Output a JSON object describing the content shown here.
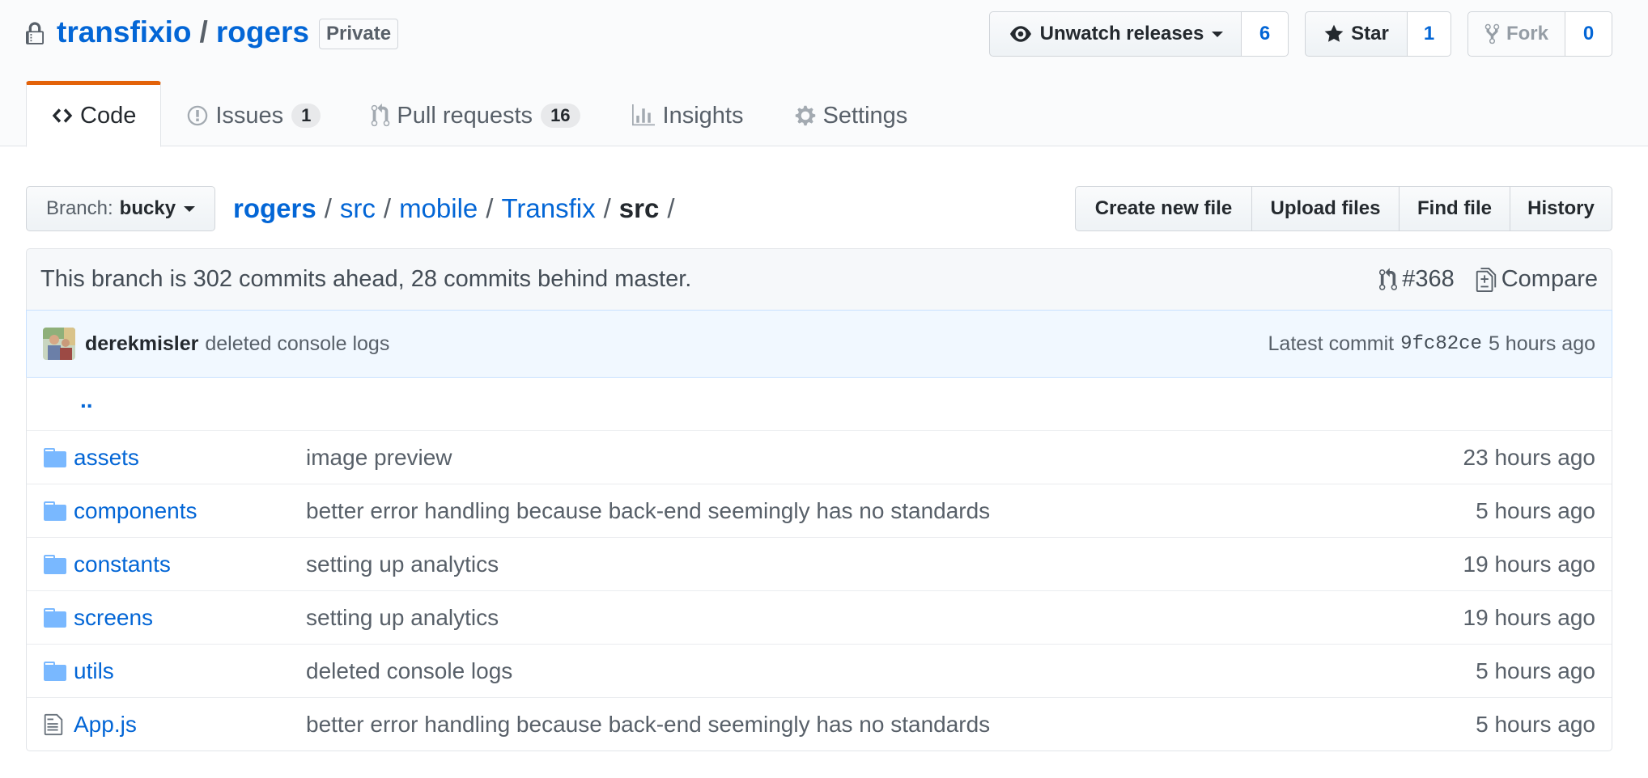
{
  "repo": {
    "owner": "transfixio",
    "separator": "/",
    "name": "rogers",
    "visibility": "Private"
  },
  "actions": {
    "watch": {
      "label": "Unwatch releases",
      "count": "6"
    },
    "star": {
      "label": "Star",
      "count": "1"
    },
    "fork": {
      "label": "Fork",
      "count": "0"
    }
  },
  "nav": {
    "code": "Code",
    "issues": {
      "label": "Issues",
      "count": "1"
    },
    "pulls": {
      "label": "Pull requests",
      "count": "16"
    },
    "insights": "Insights",
    "settings": "Settings"
  },
  "branch": {
    "prefix": "Branch:",
    "name": "bucky"
  },
  "breadcrumb": {
    "root": "rogers",
    "parts": [
      "src",
      "mobile",
      "Transfix"
    ],
    "final": "src",
    "sep": "/"
  },
  "file_actions": {
    "create": "Create new file",
    "upload": "Upload files",
    "find": "Find file",
    "history": "History"
  },
  "branch_info": {
    "text": "This branch is 302 commits ahead, 28 commits behind master.",
    "pr": "#368",
    "compare": "Compare"
  },
  "commit": {
    "author": "derekmisler",
    "message": "deleted console logs",
    "latest_label": "Latest commit",
    "sha": "9fc82ce",
    "age": "5 hours ago"
  },
  "files": {
    "up": "..",
    "rows": [
      {
        "type": "folder",
        "name": "assets",
        "message": "image preview",
        "age": "23 hours ago"
      },
      {
        "type": "folder",
        "name": "components",
        "message": "better error handling because back-end seemingly has no standards",
        "age": "5 hours ago"
      },
      {
        "type": "folder",
        "name": "constants",
        "message": "setting up analytics",
        "age": "19 hours ago"
      },
      {
        "type": "folder",
        "name": "screens",
        "message": "setting up analytics",
        "age": "19 hours ago"
      },
      {
        "type": "folder",
        "name": "utils",
        "message": "deleted console logs",
        "age": "5 hours ago"
      },
      {
        "type": "file",
        "name": "App.js",
        "message": "better error handling because back-end seemingly has no standards",
        "age": "5 hours ago"
      }
    ]
  },
  "colors": {
    "link": "#0366d6",
    "nav_accent": "#e36209",
    "folder_icon": "#79b8ff",
    "commit_bg": "#f1f8ff"
  },
  "icons": {
    "lock": "lock-icon",
    "eye": "eye-icon",
    "star": "star-icon",
    "fork": "repo-forked-icon",
    "code": "code-icon",
    "issue": "issue-opened-icon",
    "pr": "git-pull-request-icon",
    "graph": "graph-icon",
    "gear": "gear-icon",
    "folder": "file-directory-icon",
    "file": "file-icon",
    "diff": "file-diff-icon"
  }
}
